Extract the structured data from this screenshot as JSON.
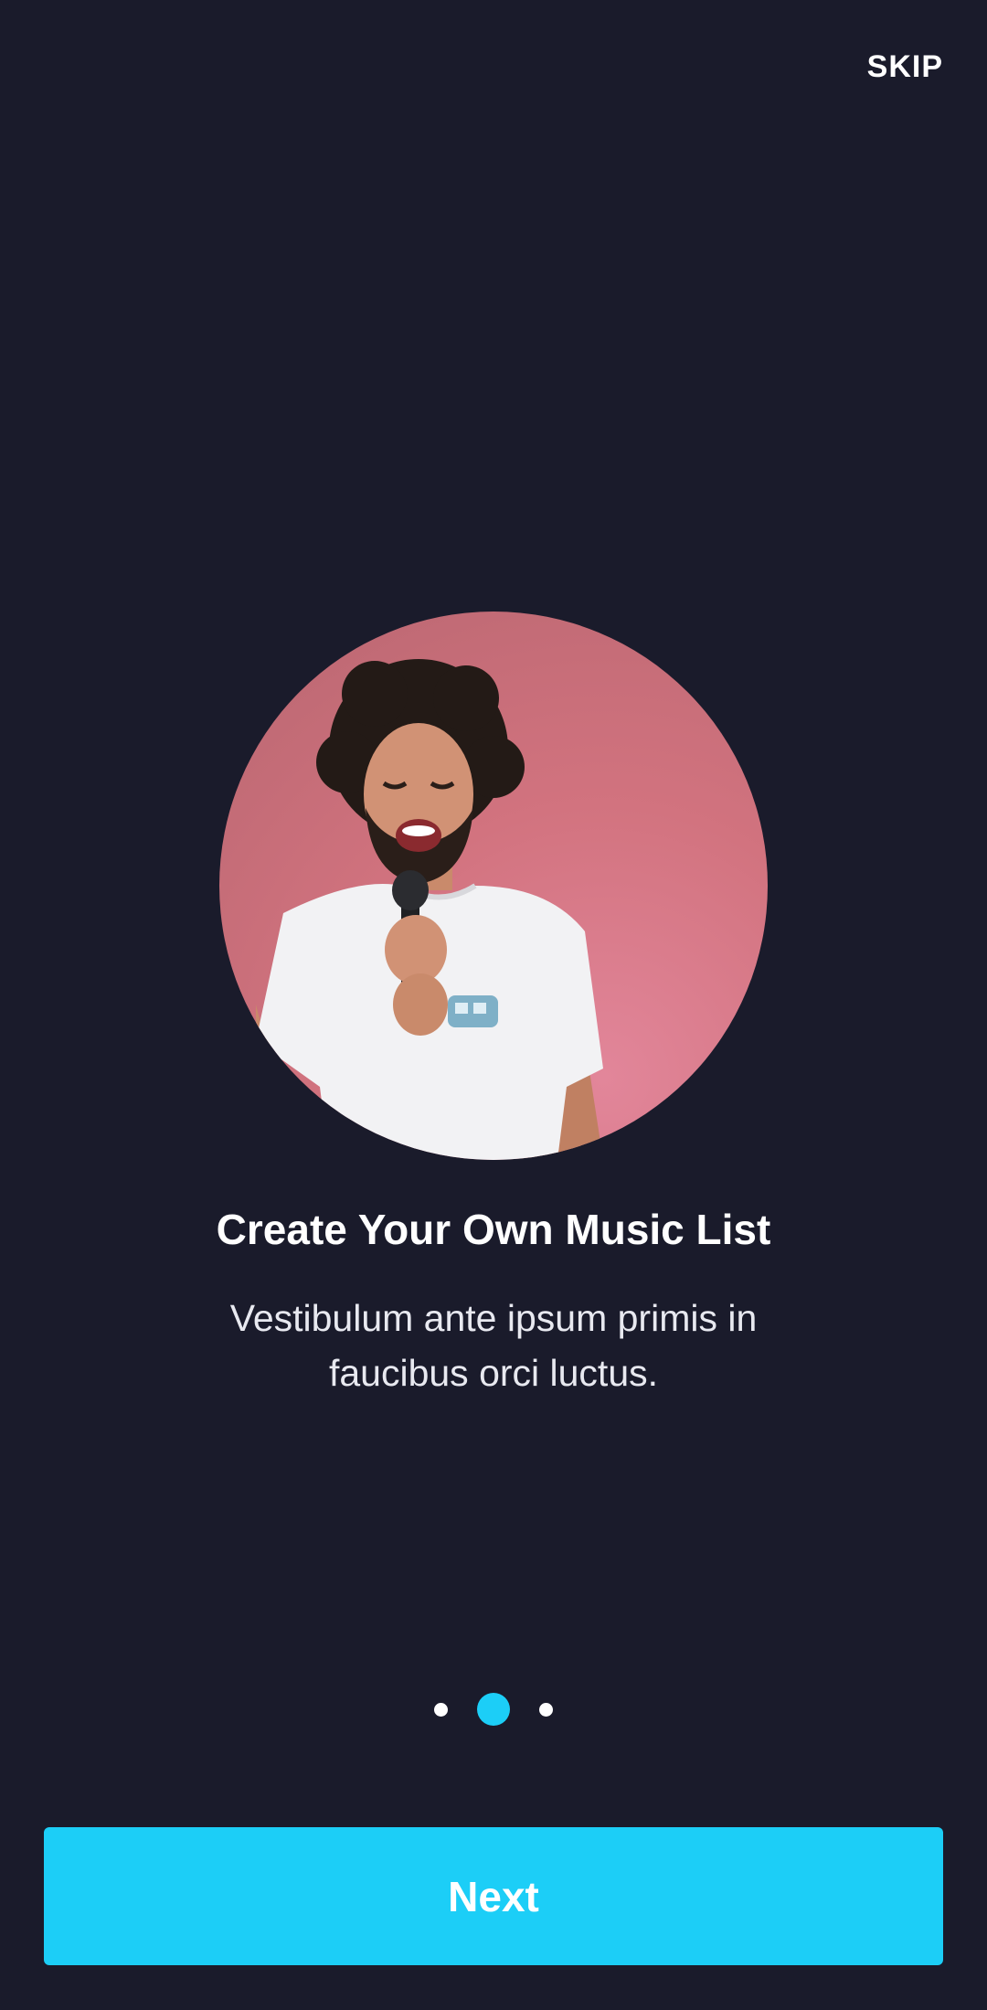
{
  "header": {
    "skip_label": "SKIP"
  },
  "onboarding": {
    "title": "Create Your Own Music List",
    "description": "Vestibulum ante ipsum primis in faucibus orci luctus.",
    "image_icon": "singer-photo",
    "current_page": 2,
    "total_pages": 3
  },
  "footer": {
    "next_label": "Next"
  },
  "colors": {
    "background": "#1a1b2b",
    "accent": "#1ccef7",
    "text": "#ffffff"
  }
}
